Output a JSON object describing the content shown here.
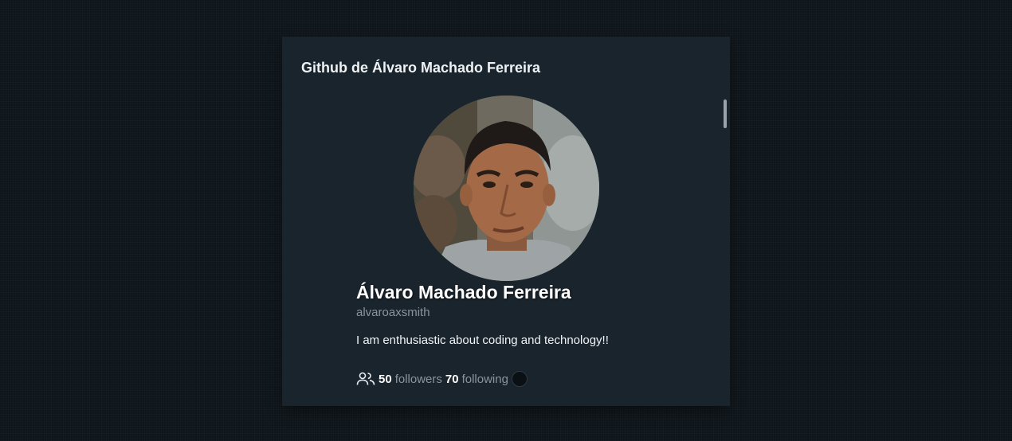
{
  "card": {
    "title": "Github de Álvaro Machado Ferreira"
  },
  "profile": {
    "name": "Álvaro Machado Ferreira",
    "username": "alvaroaxsmith",
    "bio": "I am enthusiastic about coding and technology!!",
    "followers_count": "50",
    "followers_label": "followers",
    "following_count": "70",
    "following_label": "following"
  },
  "icons": {
    "people": "people-icon",
    "status": "status-dot-icon"
  },
  "colors": {
    "page_background": "#0f161b",
    "card_background": "#1a242d",
    "text_primary": "#ffffff",
    "text_muted": "#8b949c"
  }
}
